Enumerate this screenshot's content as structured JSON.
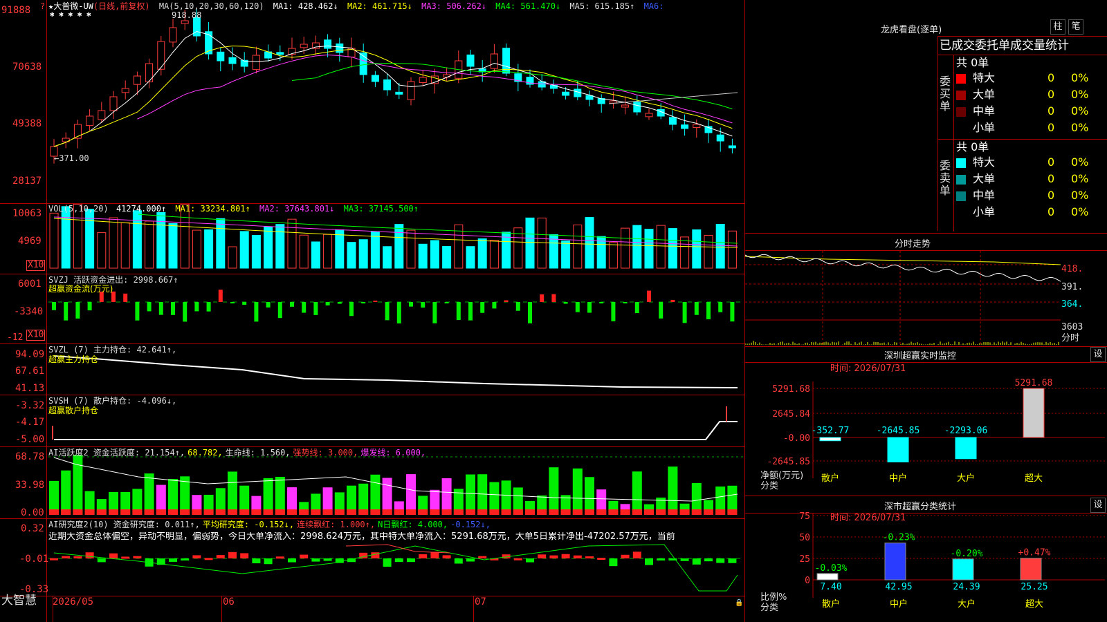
{
  "stock": {
    "name": "★大普微-UW",
    "mode": "(日线,前复权)",
    "stars": "✱ ✱ ✱   ✱ ✱"
  },
  "main": {
    "ma_label": "MA(5,10,20,30,60,120)",
    "ma1": "MA1: 428.462↓",
    "ma2": "MA2: 461.715↓",
    "ma3": "MA3: 506.262↓",
    "ma4": "MA4: 561.470↓",
    "ma5": "MA5: 615.185↑",
    "ma6": "MA6:",
    "high_mark": "918.88",
    "low_mark": "371.00",
    "axis": [
      "91888",
      "70638",
      "49388",
      "28137"
    ]
  },
  "vol": {
    "title": "VOL(5,10,20)",
    "value": "41274.000↑",
    "ma1": "MA1: 33234.801↑",
    "ma2": "MA2: 37643.801↓",
    "ma3": "MA3: 37145.500↑",
    "axis": [
      "10063",
      "4969"
    ],
    "unit": "X10"
  },
  "svzj": {
    "title": "SVZJ  活跃资金进出: 2998.667↑",
    "sub": "超赢资金流(万元)",
    "axis": [
      "6001",
      "-3340",
      "-12"
    ],
    "unit": "X10"
  },
  "svzl": {
    "title": "SVZL (7) 主力持仓: 42.641↑,",
    "sub": "超赢主力持仓",
    "axis": [
      "94.09",
      "67.61",
      "41.13"
    ]
  },
  "svsh": {
    "title": "SVSH (7) 散户持仓: -4.096↓,",
    "sub": "超赢散户持仓",
    "axis": [
      "-3.32",
      "-4.17",
      "-5.00"
    ]
  },
  "ai1": {
    "t1": "AI活跃度2 资金活跃度: 21.154↑,",
    "t2": "68.782,",
    "t3": "生命线: 1.560,",
    "t4": "强势线: 3.000,",
    "t5": "爆发线: 6.000,",
    "axis": [
      "68.78",
      "33.98",
      "0.00"
    ]
  },
  "ai2": {
    "t1": "AI研究度2(10) 资金研究度: 0.011↑,",
    "t2": "平均研究度: -0.152↓,",
    "t3": "连续飘红: 1.000↑,",
    "t4": "N日飘红: 4.000,",
    "t5": "-0.152↓,",
    "comment": "近期大资金总体偏空，异动不明显，偏弱势，今日大单净流入：2998.624万元，其中特大单净流入：5291.68万元，大单5日累计净出-47202.57万元，当前",
    "axis": [
      "0.32",
      "-0.01",
      "-0.33"
    ]
  },
  "bottom": {
    "brand": "大智慧",
    "dates": [
      "2026/05",
      "06",
      "07"
    ]
  },
  "lhb": {
    "title": "龙虎看盘(逐单)",
    "btn1": "柱",
    "btn2": "笔",
    "header": "已成交委托单成交量统计",
    "buy_total": "共 0单",
    "buy_label": "委买单",
    "sell_total": "共 0单",
    "sell_label": "委卖单",
    "buy_rows": [
      {
        "name": "特大",
        "n": "0",
        "p": "0%",
        "c": "#ff0000"
      },
      {
        "name": "大单",
        "n": "0",
        "p": "0%",
        "c": "#a00000"
      },
      {
        "name": "中单",
        "n": "0",
        "p": "0%",
        "c": "#6a0000"
      },
      {
        "name": "小单",
        "n": "0",
        "p": "0%",
        "c": "#000000"
      }
    ],
    "sell_rows": [
      {
        "name": "特大",
        "n": "0",
        "p": "0%",
        "c": "#00ffff"
      },
      {
        "name": "大单",
        "n": "0",
        "p": "0%",
        "c": "#009a9a"
      },
      {
        "name": "中单",
        "n": "0",
        "p": "0%",
        "c": "#008080"
      },
      {
        "name": "小单",
        "n": "0",
        "p": "0%",
        "c": "#000000"
      }
    ]
  },
  "fenshi": {
    "title": "分时走势",
    "axis": [
      "418.",
      "391.",
      "364.",
      "3603"
    ],
    "unit": "分时"
  },
  "sz_monitor": {
    "title": "深圳超赢实时监控",
    "btn": "设",
    "time": "时间: 2026/07/31",
    "ylabel": "净额(万元)",
    "xlabel": "分类",
    "axis": [
      "5291.68",
      "2645.84",
      "-0.00",
      "-2645.85"
    ],
    "cats": [
      "散户",
      "中户",
      "大户",
      "超大"
    ],
    "values": [
      -352.77,
      -2645.85,
      -2293.06,
      5291.68
    ],
    "value_labels": [
      "-352.77",
      "-2645.85",
      "-2293.06",
      "5291.68"
    ]
  },
  "sz_class": {
    "title": "深市超赢分类统计",
    "btn": "设",
    "time": "时间: 2026/07/31",
    "ylabel": "比例%",
    "xlabel": "分类",
    "axis": [
      "75",
      "50",
      "25",
      "0"
    ],
    "cats": [
      "散户",
      "中户",
      "大户",
      "超大"
    ],
    "values": [
      7.4,
      42.95,
      24.39,
      25.25
    ],
    "value_labels": [
      "7.40",
      "42.95",
      "24.39",
      "25.25"
    ],
    "changes": [
      "-0.03%",
      "-0.23%",
      "-0.20%",
      "+0.47%"
    ]
  }
}
